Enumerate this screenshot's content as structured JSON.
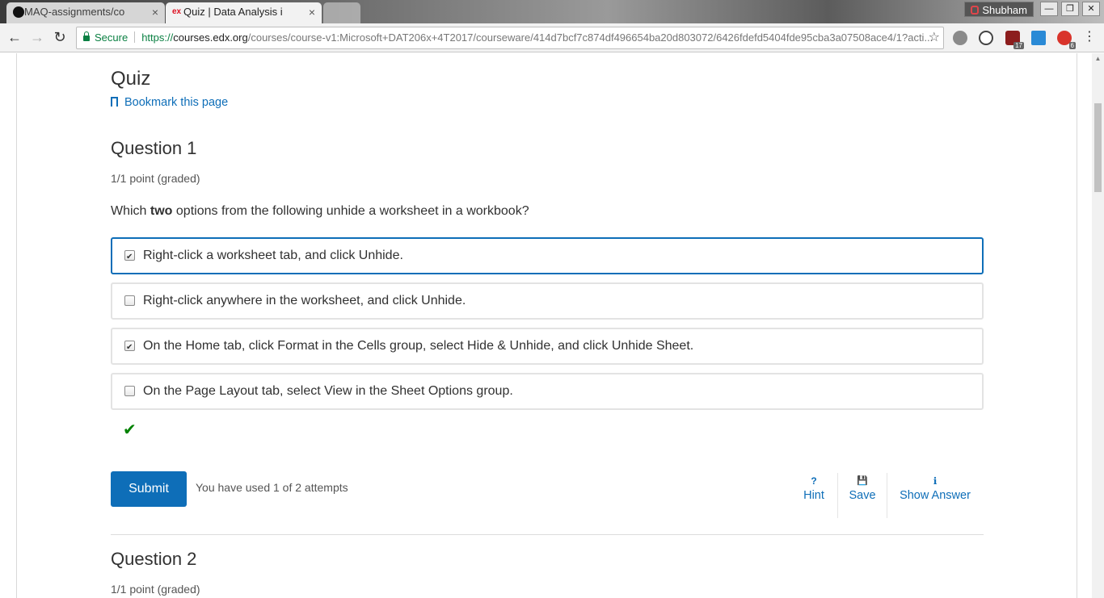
{
  "browser": {
    "tabs": [
      {
        "title": "MAQ-assignments/co",
        "icon": "github-icon",
        "close": "×",
        "active": false
      },
      {
        "title": "Quiz | Data Analysis i",
        "icon": "edx-icon",
        "close": "×",
        "active": true
      }
    ],
    "profile_name": "Shubham",
    "window_buttons": {
      "minimize": "—",
      "restore": "❐",
      "close": "✕"
    },
    "nav": {
      "back": "←",
      "forward": "→",
      "reload": "↻"
    },
    "security_label": "Secure",
    "url": {
      "scheme": "https://",
      "host": "courses.edx.org",
      "path": "/courses/course-v1:Microsoft+DAT206x+4T2017/courseware/414d7bcf7c874df496654ba20d803072/6426fdefd5404fde95cba3a07508ace4/1?acti..."
    },
    "bookmark_star": "☆",
    "extensions": [
      {
        "name": "evernote-icon",
        "badge": ""
      },
      {
        "name": "speedometer-icon",
        "badge": ""
      },
      {
        "name": "ublock-icon",
        "badge": "17"
      },
      {
        "name": "window-icon",
        "badge": ""
      },
      {
        "name": "adblock-icon",
        "badge": "6"
      }
    ]
  },
  "page": {
    "title": "Quiz",
    "bookmark_label": "Bookmark this page",
    "question1": {
      "title": "Question 1",
      "points": "1/1 point (graded)",
      "prompt_pre": "Which ",
      "prompt_bold": "two",
      "prompt_post": " options from the following unhide a worksheet in a workbook?",
      "choices": [
        {
          "label": "Right-click a worksheet tab, and click Unhide.",
          "checked": true
        },
        {
          "label": "Right-click anywhere in the worksheet, and click Unhide.",
          "checked": false
        },
        {
          "label": "On the Home tab, click Format in the Cells group, select Hide & Unhide, and click Unhide Sheet.",
          "checked": true
        },
        {
          "label": "On the Page Layout tab, select View in the Sheet Options group.",
          "checked": false
        }
      ],
      "status_icon": "✔",
      "submit_label": "Submit",
      "attempts_text": "You have used 1 of 2 attempts",
      "actions": {
        "hint": {
          "icon": "?",
          "label": "Hint"
        },
        "save": {
          "icon": "💾",
          "label": "Save"
        },
        "show_answer": {
          "icon": "ℹ",
          "label": "Show Answer"
        }
      }
    },
    "question2": {
      "title": "Question 2",
      "points": "1/1 point (graded)"
    }
  },
  "colors": {
    "accent": "#0e6eb8",
    "correct": "#008100",
    "secure": "#0b8043"
  }
}
